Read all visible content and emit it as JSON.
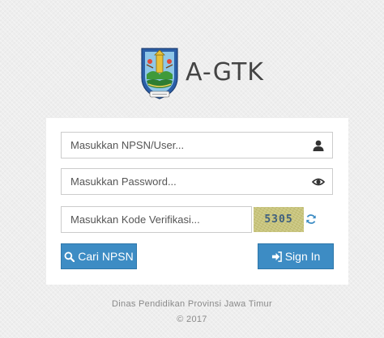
{
  "brand": {
    "name": "A-GTK"
  },
  "form": {
    "user_placeholder": "Masukkan NPSN/User...",
    "password_placeholder": "Masukkan Password...",
    "code_placeholder": "Masukkan Kode Verifikasi...",
    "captcha_code": "5305",
    "cari_label": "Cari NPSN",
    "signin_label": "Sign In"
  },
  "footer": {
    "line1": "Dinas Pendidikan Provinsi Jawa Timur",
    "line2": "© 2017"
  },
  "icons": {
    "user": "user-icon",
    "password": "eye-icon",
    "refresh": "refresh-icon",
    "search": "search-icon",
    "signin": "sign-in-icon"
  },
  "colors": {
    "button": "#3d8cc4",
    "captcha_bg": "#c8c47a",
    "refresh": "#3d8cc4"
  }
}
